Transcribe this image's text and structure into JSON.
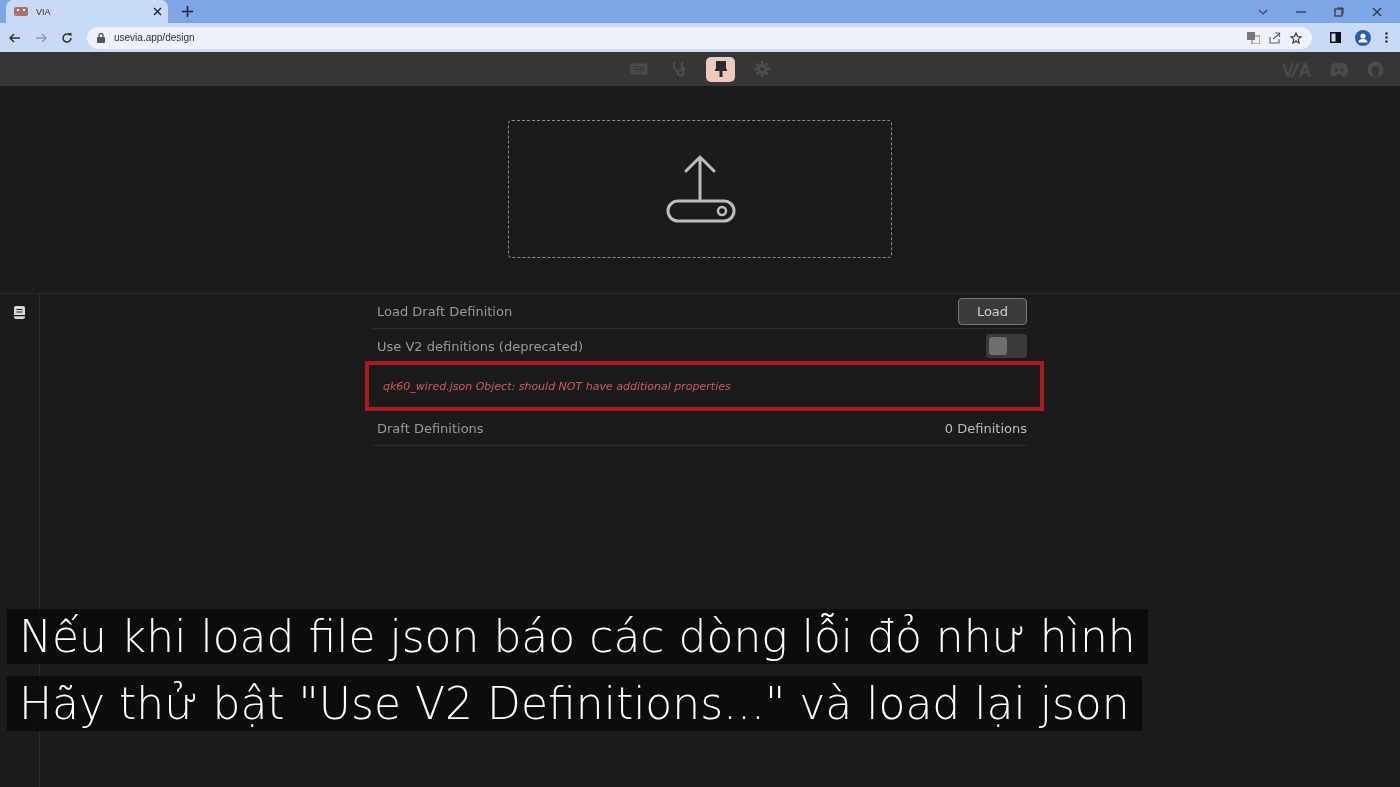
{
  "browser": {
    "tab": {
      "title": "VIA"
    },
    "address": "usevia.app/design"
  },
  "app_nav": [
    {
      "kind": "keyboard",
      "selected": false
    },
    {
      "kind": "stethoscope",
      "selected": false
    },
    {
      "kind": "brush",
      "selected": true
    },
    {
      "kind": "gear",
      "selected": false
    }
  ],
  "settings": [
    {
      "kind": "button",
      "label": "Load Draft Definition",
      "button": "Load"
    },
    {
      "kind": "toggle",
      "label": "Use V2 definitions (deprecated)",
      "on": false
    },
    {
      "kind": "error",
      "message": "qk60_wired.json Object: should NOT have additional properties",
      "highlighted": true
    },
    {
      "kind": "value",
      "label": "Draft Definitions",
      "value": "0 Definitions"
    }
  ],
  "captions": [
    "Nếu khi load file json báo các dòng lỗi đỏ như hình",
    "Hãy thử bật \"Use V2 Definitions...\" và load lại json"
  ]
}
